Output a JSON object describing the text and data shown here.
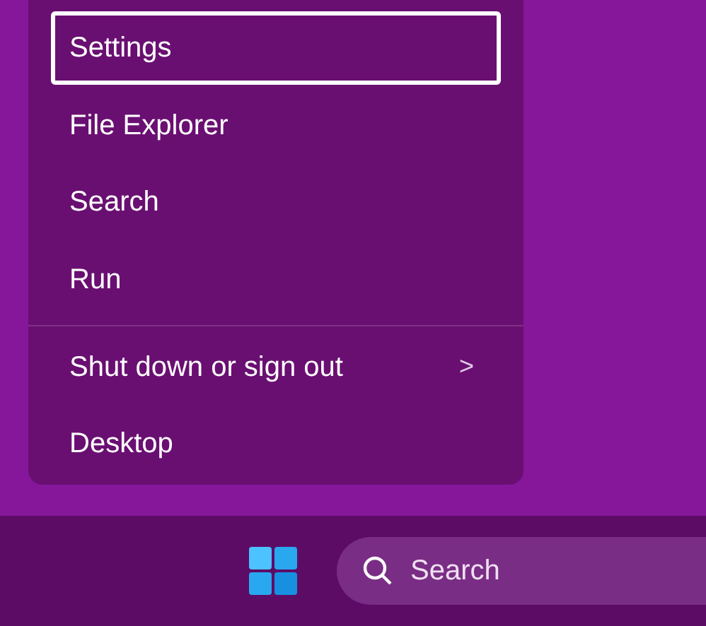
{
  "menu": {
    "items": [
      {
        "label": "Settings",
        "selected": true,
        "kind": "item"
      },
      {
        "label": "File Explorer",
        "selected": false,
        "kind": "item"
      },
      {
        "label": "Search",
        "selected": false,
        "kind": "item"
      },
      {
        "label": "Run",
        "selected": false,
        "kind": "item"
      },
      {
        "label": "Shut down or sign out",
        "selected": false,
        "kind": "submenu",
        "arrow": ">"
      },
      {
        "label": "Desktop",
        "selected": false,
        "kind": "item"
      }
    ]
  },
  "taskbar": {
    "search": {
      "placeholder": "Search"
    }
  }
}
